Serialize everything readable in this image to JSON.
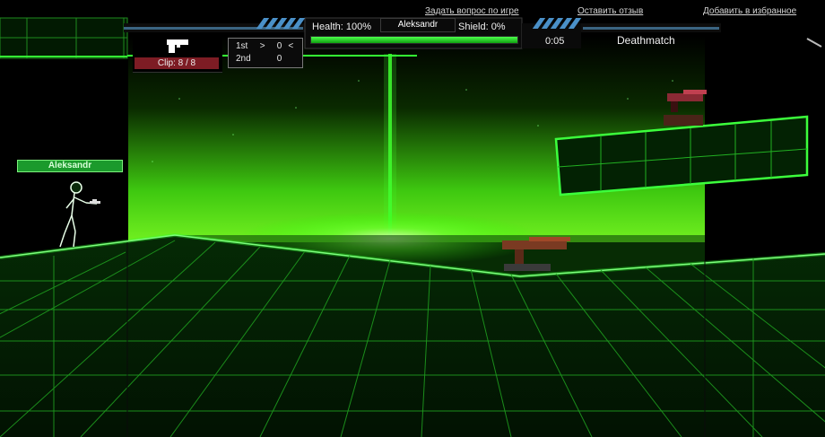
{
  "links": {
    "ask_question": "Задать вопрос по игре",
    "leave_review": "Оставить отзыв",
    "add_favorite": "Добавить в избранное"
  },
  "hud": {
    "health_label": "Health: 100%",
    "health_value": 100,
    "player_name": "Aleksandr",
    "shield_label": "Shield: 0%",
    "shield_value": 0,
    "timer": "0:05",
    "mode": "Deathmatch",
    "clip": "Clip: 8 / 8",
    "weapon_icon": "pistol-icon",
    "scoreboard": [
      {
        "place": "1st",
        "marker": ">",
        "score": "0",
        "end": "<"
      },
      {
        "place": "2nd",
        "marker": "",
        "score": "0",
        "end": ""
      }
    ]
  },
  "player_tag": "Aleksandr",
  "colors": {
    "neon_green": "#22ff22",
    "hud_blue": "#4a90c8",
    "clip_red": "#7d1c24",
    "background": "#000000"
  }
}
